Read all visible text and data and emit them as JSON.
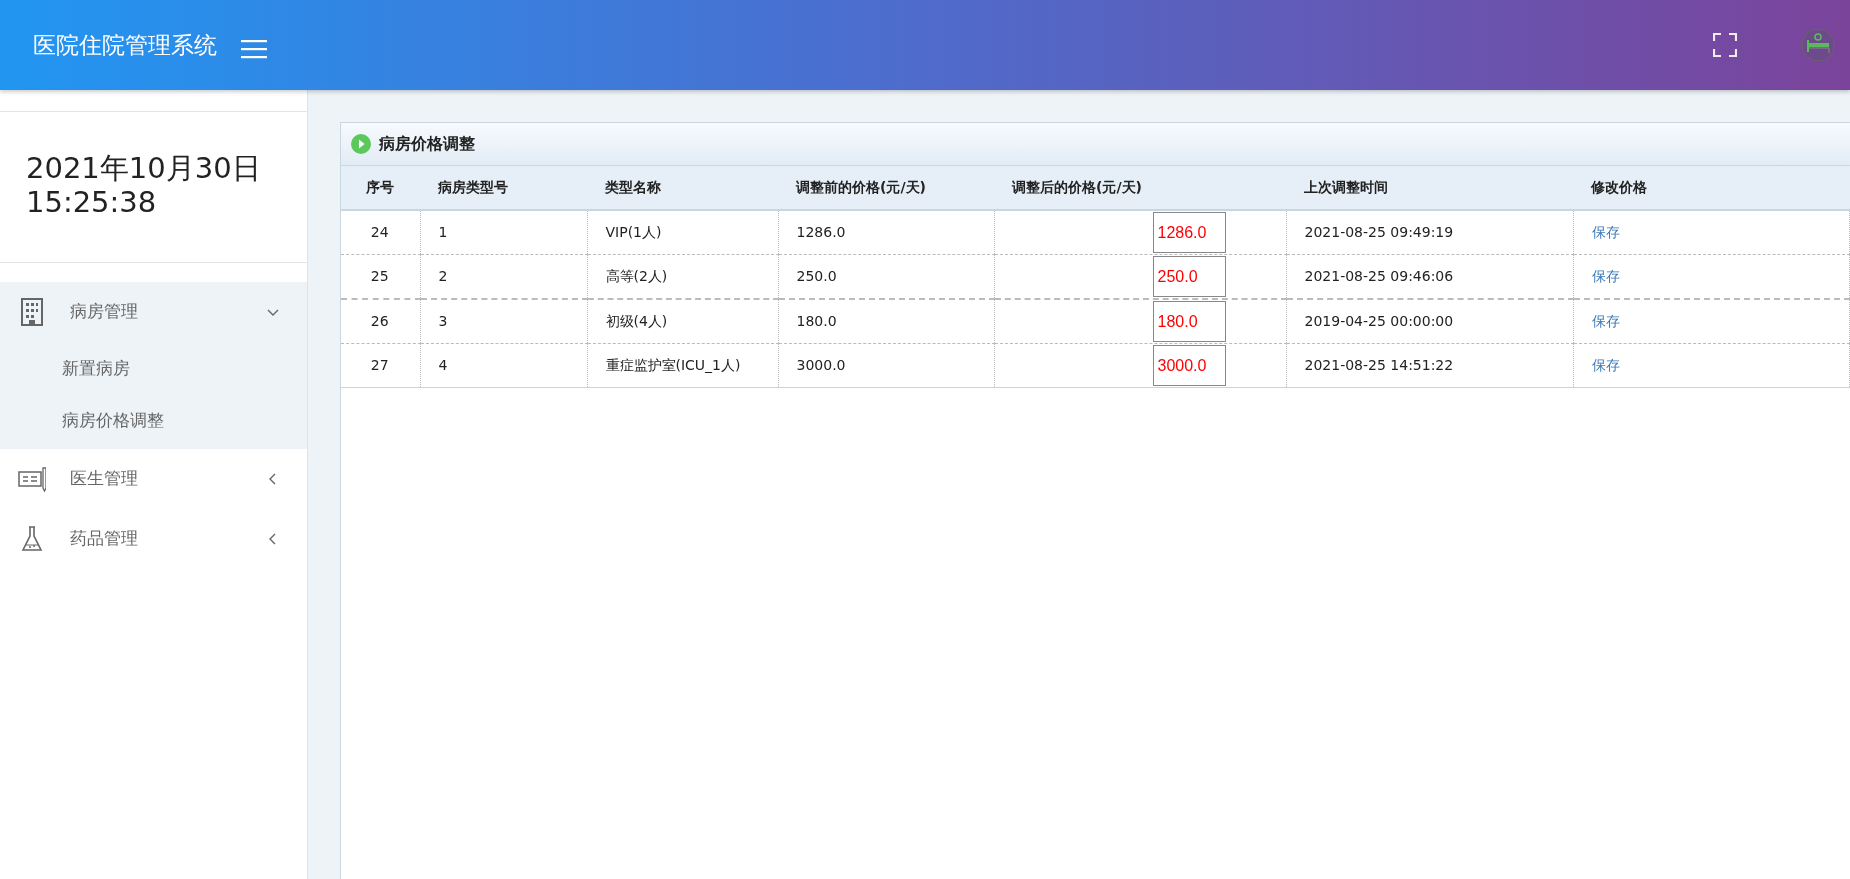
{
  "header": {
    "title": "医院住院管理系统"
  },
  "sidebar": {
    "date": "2021年10月30日",
    "time": "15:25:38",
    "items": [
      {
        "label": "病房管理",
        "expanded": true,
        "children": [
          {
            "label": "新置病房"
          },
          {
            "label": "病房价格调整"
          }
        ]
      },
      {
        "label": "医生管理",
        "expanded": false
      },
      {
        "label": "药品管理",
        "expanded": false
      }
    ]
  },
  "panel": {
    "title": "病房价格调整",
    "table": {
      "columns": [
        "序号",
        "病房类型号",
        "类型名称",
        "调整前的价格(元/天)",
        "调整后的价格(元/天)",
        "上次调整时间",
        "修改价格"
      ],
      "rows": [
        {
          "no": "24",
          "type_no": "1",
          "type_name": "VIP(1人)",
          "old_price": "1286.0",
          "new_price": "1286.0",
          "last_time": "2021-08-25 09:49:19",
          "action": "保存"
        },
        {
          "no": "25",
          "type_no": "2",
          "type_name": "高等(2人)",
          "old_price": "250.0",
          "new_price": "250.0",
          "last_time": "2021-08-25 09:46:06",
          "action": "保存"
        },
        {
          "no": "26",
          "type_no": "3",
          "type_name": "初级(4人)",
          "old_price": "180.0",
          "new_price": "180.0",
          "last_time": "2019-04-25 00:00:00",
          "action": "保存"
        },
        {
          "no": "27",
          "type_no": "4",
          "type_name": "重症监护室(ICU_1人)",
          "old_price": "3000.0",
          "new_price": "3000.0",
          "last_time": "2021-08-25 14:51:22",
          "action": "保存"
        }
      ]
    }
  }
}
